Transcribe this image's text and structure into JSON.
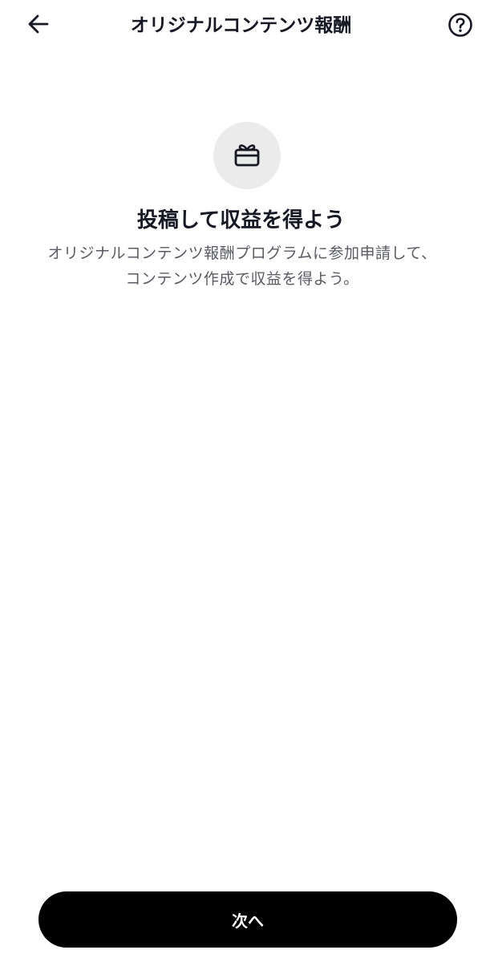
{
  "header": {
    "title": "オリジナルコンテンツ報酬",
    "back_icon": "arrow-left-icon",
    "help_icon": "question-circle-icon"
  },
  "hero": {
    "icon": "gift-icon",
    "title": "投稿して収益を得よう",
    "description": "オリジナルコンテンツ報酬プログラムに参加申請して、コンテンツ作成で収益を得よう。"
  },
  "footer": {
    "next_label": "次へ"
  },
  "colors": {
    "primary_button": "#000000",
    "icon_circle_bg": "#ebebeb",
    "text_primary": "#161823",
    "text_secondary": "#5a5b63"
  }
}
